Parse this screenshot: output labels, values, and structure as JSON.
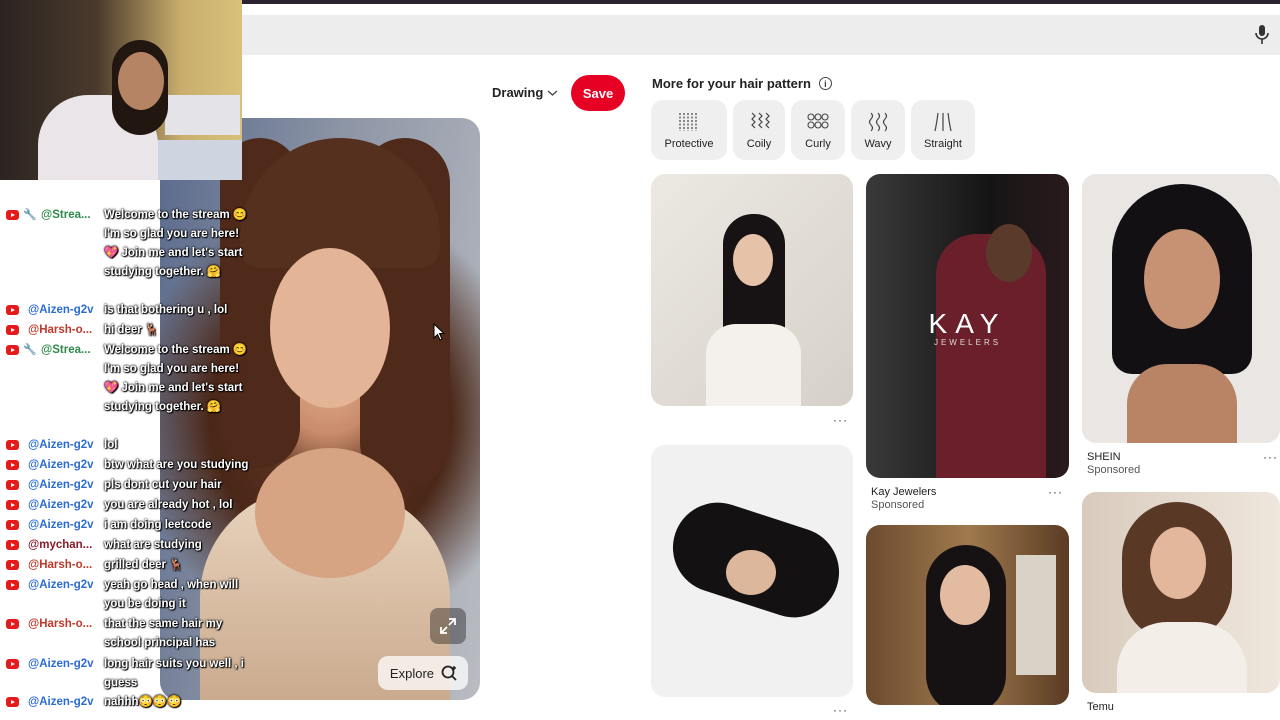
{
  "pin": {
    "board_select": "Drawing",
    "save_label": "Save",
    "explore_label": "Explore"
  },
  "more": {
    "title": "More for your hair pattern",
    "chips": [
      {
        "label": "Protective",
        "icon": "protective-hair-icon"
      },
      {
        "label": "Coily",
        "icon": "coily-hair-icon"
      },
      {
        "label": "Curly",
        "icon": "curly-hair-icon"
      },
      {
        "label": "Wavy",
        "icon": "wavy-hair-icon"
      },
      {
        "label": "Straight",
        "icon": "straight-hair-icon"
      }
    ],
    "cards": {
      "kay": {
        "overlay": "KAY",
        "overlay_sub": "JEWELERS",
        "title": "Kay Jewelers",
        "sub": "Sponsored"
      },
      "shein": {
        "title": "SHEIN",
        "sub": "Sponsored"
      },
      "temu": {
        "title": "Temu"
      }
    },
    "more_dots": "···"
  },
  "chat": [
    {
      "user": "@Strea...",
      "color": "#2f8a4a",
      "mod": true,
      "text": "Welcome to the stream 😊 I'm so glad you are here! 💖 Join me and let's start studying together. 🤗"
    },
    {
      "user": "@Aizen-g2v",
      "color": "#2a6bd6",
      "text": "is that bothering u , lol"
    },
    {
      "user": "@Harsh-o...",
      "color": "#c0392b",
      "text": "hi deer 🦌"
    },
    {
      "user": "@Strea...",
      "color": "#2f8a4a",
      "mod": true,
      "text": "Welcome to the stream 😊 I'm so glad you are here! 💖 Join me and let's start studying together. 🤗"
    },
    {
      "user": "@Aizen-g2v",
      "color": "#2a6bd6",
      "text": "lol"
    },
    {
      "user": "@Aizen-g2v",
      "color": "#2a6bd6",
      "text": "btw what are you studying"
    },
    {
      "user": "@Aizen-g2v",
      "color": "#2a6bd6",
      "text": "pls dont cut your hair"
    },
    {
      "user": "@Aizen-g2v",
      "color": "#2a6bd6",
      "text": "you are already hot , lol"
    },
    {
      "user": "@Aizen-g2v",
      "color": "#2a6bd6",
      "text": "i am doing leetcode"
    },
    {
      "user": "@mychan...",
      "color": "#8a1c2a",
      "text": "what are studying"
    },
    {
      "user": "@Harsh-o...",
      "color": "#c0392b",
      "text": "grilled deer 🦌"
    },
    {
      "user": "@Aizen-g2v",
      "color": "#2a6bd6",
      "text": "yeah go head , when will you be doing it"
    },
    {
      "user": "@Harsh-o...",
      "color": "#c0392b",
      "text": "that the same hair my school principal has"
    },
    {
      "user": "@Aizen-g2v",
      "color": "#2a6bd6",
      "text": "long hair suits you well , i guess"
    },
    {
      "user": "@Aizen-g2v",
      "color": "#2a6bd6",
      "text": "nahhh😳😳😳"
    }
  ],
  "colors": {
    "save": "#e60023",
    "youtube": "#e61a1a"
  }
}
